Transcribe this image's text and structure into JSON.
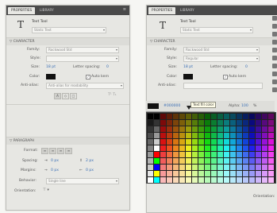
{
  "left_panel": {
    "tabs": [
      "PROPERTIES",
      "LIBRARY"
    ],
    "tool_title": "Text Tool",
    "text_type": "Static Text",
    "character_header": "CHARACTER",
    "family_label": "Family:",
    "family_value": "Rockwood Std",
    "style_label": "Style:",
    "style_value": "",
    "size_label": "Size:",
    "size_value": "18 pt",
    "letter_spacing_label": "Letter spacing:",
    "letter_spacing_value": "0",
    "color_label": "Color:",
    "auto_kern_label": "Auto kern",
    "anti_alias_label": "Anti-alias:",
    "anti_alias_value": "Anti-alias for readability",
    "paragraph_header": "PARAGRAPH",
    "format_label": "Format:",
    "spacing_label": "Spacing:",
    "spacing_indent": "0 px",
    "spacing_line": "2 px",
    "margins_label": "Margins:",
    "margin_left": "0 px",
    "margin_right": "0 px",
    "behavior_label": "Behavior:",
    "behavior_value": "Single line",
    "orientation_label": "Orientation:"
  },
  "right_panel": {
    "tabs": [
      "PROPERTIES",
      "LIBRARY"
    ],
    "tool_title": "Text Tool",
    "text_type": "Static Text",
    "character_header": "CHARACTER",
    "family_label": "Family:",
    "family_value": "Rockwood Std",
    "style_label": "Style:",
    "style_value": "Regular",
    "size_label": "Size:",
    "size_value": "18 pt",
    "letter_spacing_label": "Letter spacing:",
    "letter_spacing_value": "0",
    "color_label": "Color:",
    "auto_kern_label": "Auto kern",
    "anti_alias_label": "Anti-alias:",
    "hex_value": "#000000",
    "tooltip": "Text fill color",
    "alpha_label": "Alpha:",
    "alpha_value": "100",
    "orientation_label": "Orientation:"
  },
  "icons": {
    "text_tool": "text-tool-icon",
    "section_arrow": "disclosure-triangle-icon"
  }
}
